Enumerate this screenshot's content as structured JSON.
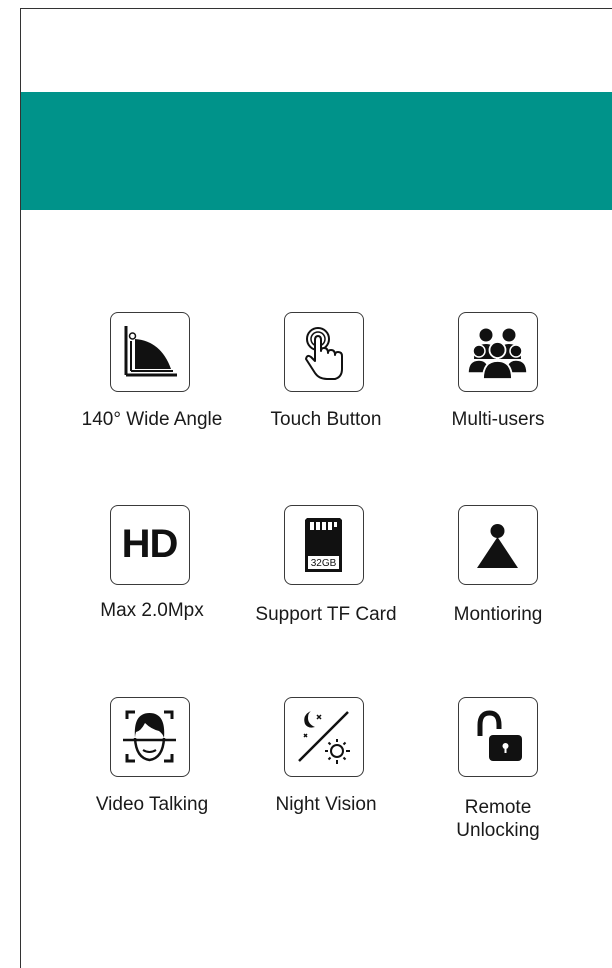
{
  "colors": {
    "banner": "#00938a",
    "icon_stroke": "#3a3a3a",
    "icon_fill": "#111111"
  },
  "features": [
    {
      "label": "140° Wide Angle",
      "icon": "wide-angle-icon"
    },
    {
      "label": "Touch Button",
      "icon": "touch-button-icon"
    },
    {
      "label": "Multi-users",
      "icon": "multi-users-icon"
    },
    {
      "label": "Max 2.0Mpx",
      "icon": "hd-icon",
      "icon_text": "HD"
    },
    {
      "label": "Support TF Card",
      "icon": "sd-card-icon",
      "icon_text": "32GB"
    },
    {
      "label": "Montioring",
      "icon": "monitoring-icon"
    },
    {
      "label": "Video Talking",
      "icon": "face-scan-icon"
    },
    {
      "label": "Night Vision",
      "icon": "day-night-icon"
    },
    {
      "label_line1": "Remote",
      "label_line2": "Unlocking",
      "icon": "unlock-icon"
    }
  ]
}
